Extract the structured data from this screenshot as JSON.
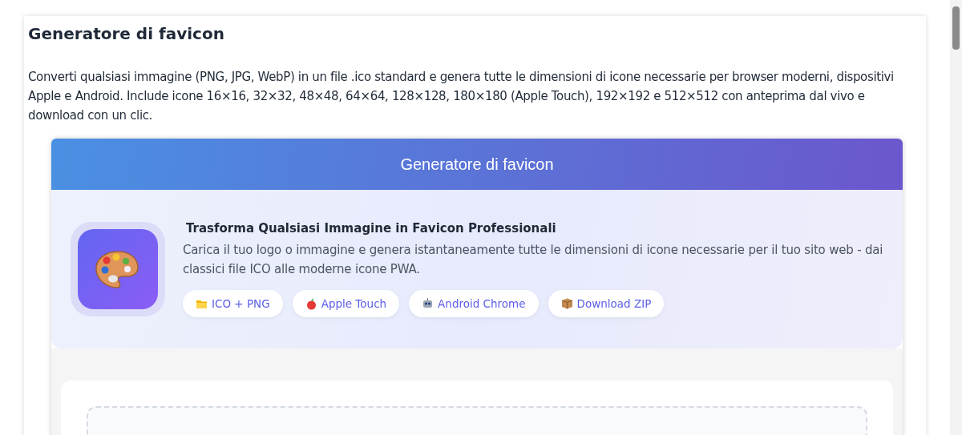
{
  "page": {
    "title": "Generatore di favicon",
    "description": "Converti qualsiasi immagine (PNG, JPG, WebP) in un file .ico standard e genera tutte le dimensioni di icone necessarie per browser moderni, dispositivi Apple e Android. Include icone 16×16, 32×32, 48×48, 64×64, 128×128, 180×180 (Apple Touch), 192×192 e 512×512 con anteprima dal vivo e download con un clic."
  },
  "tool": {
    "header": "Generatore di favicon",
    "hero": {
      "title": "Trasforma Qualsiasi Immagine in Favicon Professionali",
      "text": "Carica il tuo logo o immagine e genera istantaneamente tutte le dimensioni di icone necessarie per il tuo sito web - dai classici file ICO alle moderne icone PWA.",
      "badges": [
        {
          "kind": "folder",
          "label": "ICO + PNG"
        },
        {
          "kind": "apple",
          "label": "Apple Touch"
        },
        {
          "kind": "robot",
          "label": "Android Chrome"
        },
        {
          "kind": "package",
          "label": "Download ZIP"
        }
      ]
    }
  }
}
